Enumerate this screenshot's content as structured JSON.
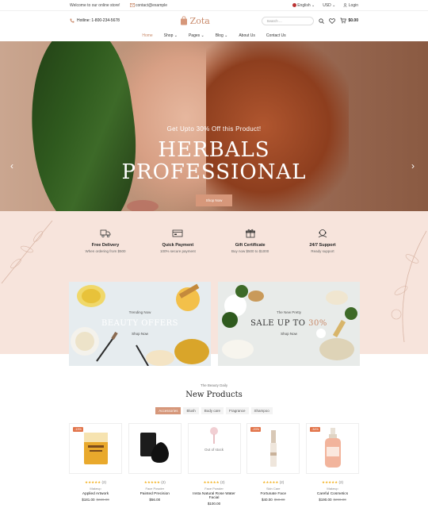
{
  "topbar": {
    "welcome": "Welcome to our online store!",
    "email": "contact@example",
    "language": "English",
    "currency": "USD",
    "login": "Login"
  },
  "header": {
    "hotline": "Hotline: 1-800-234-5678",
    "logo": "Zota",
    "search_placeholder": "Search ...",
    "cart_total": "$0.00"
  },
  "nav": {
    "items": [
      "Home",
      "Shop",
      "Pages",
      "Blog",
      "About Us",
      "Contact Us"
    ]
  },
  "hero": {
    "subtitle": "Get Upto 30% Off this Product!",
    "title_line1": "HERBALS",
    "title_line2": "PROFESSIONAL",
    "button": "Shop Now"
  },
  "features": [
    {
      "title": "Free Delivery",
      "text": "When ordering from $500",
      "icon": "truck-icon"
    },
    {
      "title": "Quick Payment",
      "text": "100% secure payment",
      "icon": "payment-icon"
    },
    {
      "title": "Gift Certificate",
      "text": "Buy now $500 to $1000",
      "icon": "gift-icon"
    },
    {
      "title": "24/7 Support",
      "text": "Ready support",
      "icon": "support-icon"
    }
  ],
  "banners": [
    {
      "tag": "Trending Now",
      "heading": "BEAUTY OFFERS",
      "link": "Shop Now"
    },
    {
      "tag": "The New Pretty",
      "heading": "SALE UP TO",
      "heading_accent": "30%",
      "link": "Shop Now"
    }
  ],
  "products_section": {
    "subtitle": "The Beauty Daily",
    "title": "New Products",
    "tabs": [
      "Accessories",
      "Blush",
      "Body care",
      "Fragrance",
      "Shampoo"
    ]
  },
  "products": [
    {
      "badge": "-13%",
      "rating_count": "(2)",
      "category": "Makeup",
      "name": "Applied Artwork",
      "price": "$181.00",
      "old_price": "$220.00",
      "out_of_stock": ""
    },
    {
      "badge": "",
      "rating_count": "(2)",
      "category": "Face Powder",
      "name": "Painted Precision",
      "price": "$56.00",
      "old_price": "",
      "out_of_stock": ""
    },
    {
      "badge": "",
      "rating_count": "(2)",
      "category": "Face Powder",
      "name": "Insta Natural Rose Water Facial",
      "price": "$100.00",
      "old_price": "",
      "out_of_stock": "Out of stock"
    },
    {
      "badge": "-20%",
      "rating_count": "(2)",
      "category": "Skin Care",
      "name": "Fortunate Face",
      "price": "$40.00",
      "old_price": "$50.00",
      "out_of_stock": ""
    },
    {
      "badge": "-34%",
      "rating_count": "(2)",
      "category": "Makeup",
      "name": "Careful Cosmetics",
      "price": "$190.00",
      "old_price": "$290.00",
      "out_of_stock": ""
    }
  ],
  "colors": {
    "accent": "#d6977a",
    "feature_bg": "#f7e4dc",
    "sale_badge": "#e2744a",
    "star": "#f2b01e"
  }
}
